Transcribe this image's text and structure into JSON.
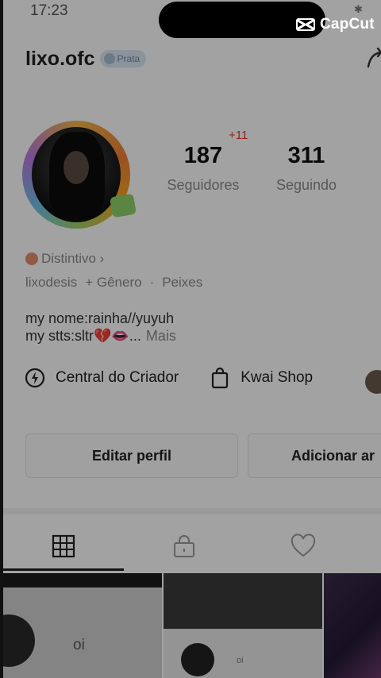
{
  "status_bar": {
    "time": "17:23"
  },
  "watermark": {
    "text": "CapCut"
  },
  "profile": {
    "username": "lixo.ofc",
    "tier_badge": "Prata",
    "followers_delta": "+11",
    "followers_count": "187",
    "followers_label": "Seguidores",
    "following_count": "311",
    "following_label": "Seguindo",
    "badge_link": "Distintivo ›",
    "tags": [
      "lixodesis",
      "+ Gênero",
      "·",
      "Peixes"
    ],
    "bio_line1": "my nome:rainha//yuyuh",
    "bio_line2": "my stts:sltr💔👄...",
    "bio_more": "Mais"
  },
  "tools": {
    "creator_center": "Central do Criador",
    "kwai_shop": "Kwai Shop"
  },
  "actions": {
    "edit_profile": "Editar perfil",
    "add_friends": "Adicionar ar"
  },
  "tabs": [
    "grid-icon",
    "lock-icon",
    "heart-icon"
  ],
  "grid_items": [
    {
      "caption": "oi"
    },
    {
      "caption": "oi"
    }
  ],
  "colors": {
    "accent_red": "#e33333",
    "badge_bg": "#d9e6f2"
  }
}
